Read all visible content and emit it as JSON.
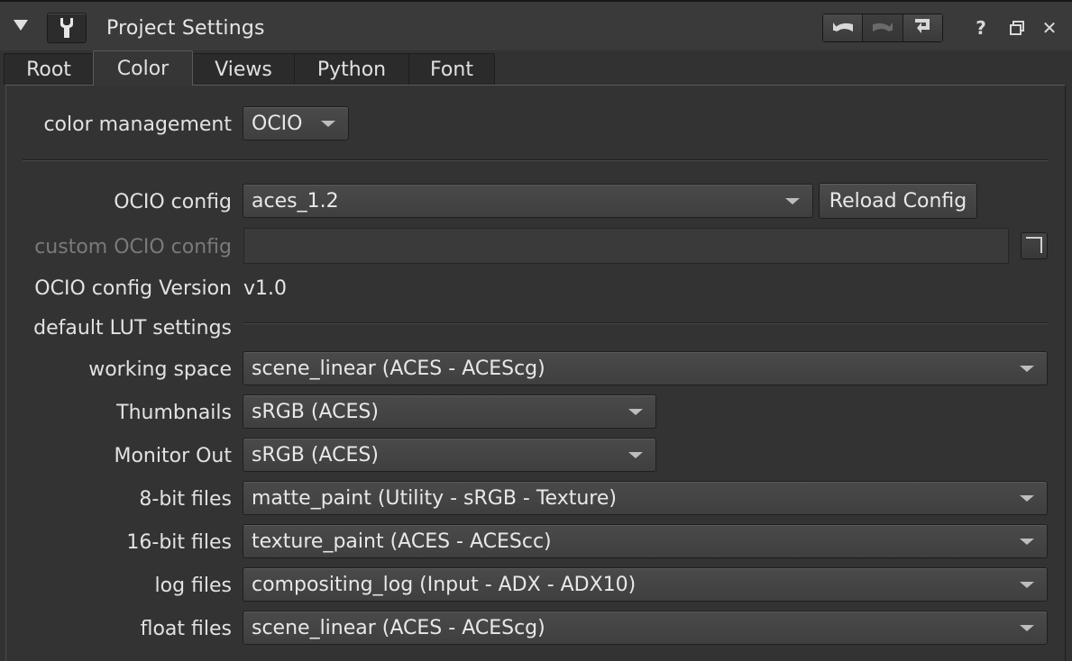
{
  "window": {
    "title": "Project Settings",
    "icons": [
      "collapse-triangle-icon",
      "wrench-icon",
      "undo-icon",
      "redo-icon",
      "revert-icon",
      "help-icon",
      "float-window-icon",
      "close-icon"
    ],
    "help_glyph": "?",
    "close_glyph": "✕"
  },
  "tabs": [
    {
      "label": "Root"
    },
    {
      "label": "Color"
    },
    {
      "label": "Views"
    },
    {
      "label": "Python"
    },
    {
      "label": "Font"
    }
  ],
  "active_tab": "Color",
  "color": {
    "color_management": {
      "label": "color management",
      "value": "OCIO"
    },
    "ocio_config": {
      "label": "OCIO config",
      "value": "aces_1.2",
      "reload_label": "Reload Config"
    },
    "custom_ocio_config": {
      "label": "custom OCIO config",
      "value": "",
      "enabled": false
    },
    "ocio_config_version": {
      "label": "OCIO config Version",
      "value": "v1.0"
    },
    "lut_section": {
      "label": "default LUT settings"
    },
    "lut_rows": [
      {
        "label": "working space",
        "value": "scene_linear (ACES - ACEScg)"
      },
      {
        "label": "Thumbnails",
        "value": "sRGB (ACES)"
      },
      {
        "label": "Monitor Out",
        "value": "sRGB (ACES)"
      },
      {
        "label": "8-bit files",
        "value": "matte_paint (Utility - sRGB - Texture)"
      },
      {
        "label": "16-bit files",
        "value": "texture_paint (ACES - ACEScc)"
      },
      {
        "label": "log files",
        "value": "compositing_log (Input - ADX - ADX10)"
      },
      {
        "label": "float files",
        "value": "scene_linear (ACES - ACEScg)"
      }
    ]
  }
}
